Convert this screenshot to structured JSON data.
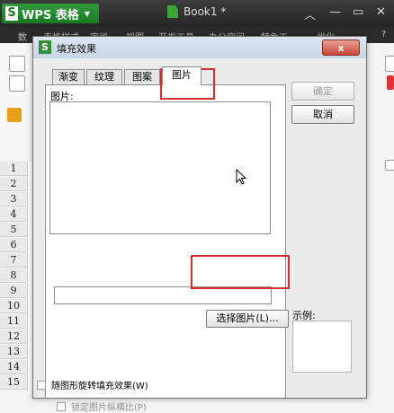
{
  "app": {
    "name": "WPS 表格",
    "document_title": "Book1 *",
    "menu": [
      "数",
      "表格样式",
      "审阅",
      "视图",
      "开发工具",
      "办公空间",
      "特色工",
      "优化",
      "?"
    ]
  },
  "sheet": {
    "row_numbers": [
      "1",
      "2",
      "3",
      "4",
      "5",
      "6",
      "7",
      "8",
      "9",
      "10",
      "11",
      "12",
      "13",
      "14",
      "15"
    ]
  },
  "dialog": {
    "title": "填充效果",
    "close_label": "x",
    "tabs": [
      {
        "label": "渐变",
        "active": false
      },
      {
        "label": "纹理",
        "active": false
      },
      {
        "label": "图案",
        "active": false
      },
      {
        "label": "图片",
        "active": true
      }
    ],
    "panel_label": "图片:",
    "picture_path": "",
    "select_picture_button": "选择图片(L)...",
    "lock_aspect_checkbox": {
      "label": "锁定图片纵横比(P)",
      "checked": false,
      "enabled": false
    },
    "rotate_with_shape_checkbox": {
      "label": "随图形旋转填充效果(W)",
      "checked": false
    },
    "ok_button": "确定",
    "cancel_button": "取消",
    "example_label": "示例:"
  },
  "colors": {
    "wps_green": "#1b7a25",
    "highlight_red": "#d92d2d",
    "close_button_red": "#c9473a"
  }
}
